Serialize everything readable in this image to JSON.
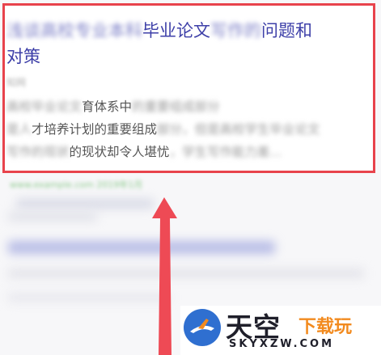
{
  "result": {
    "title_blurred_prefix": "浅谈高校专业本科",
    "title_visible_1": "毕业论文",
    "title_blurred_mid": "写作的",
    "title_visible_2": "问题和",
    "title_line2": "对策",
    "meta_blurred": "知网",
    "snippet_line1_blurred_a": "高校毕业论文",
    "snippet_line1_visible": "育体系中",
    "snippet_line1_blurred_b": "的重要组成部分",
    "snippet_line2_blurred_a": "是人",
    "snippet_line2_visible": "才培养计划的重要组成",
    "snippet_line2_blurred_b": "部分，但是高校学生毕业论文",
    "snippet_line3_blurred_a": "写作的现状",
    "snippet_line3_visible": "的现状却令人堪忧",
    "snippet_line3_blurred_b": "，学生写作能力差...",
    "source_blurred": "www.example.com 2019年1月"
  },
  "watermark": {
    "brand": "天空",
    "sub": "下载玩",
    "domain": "SKYXZW.COM"
  }
}
